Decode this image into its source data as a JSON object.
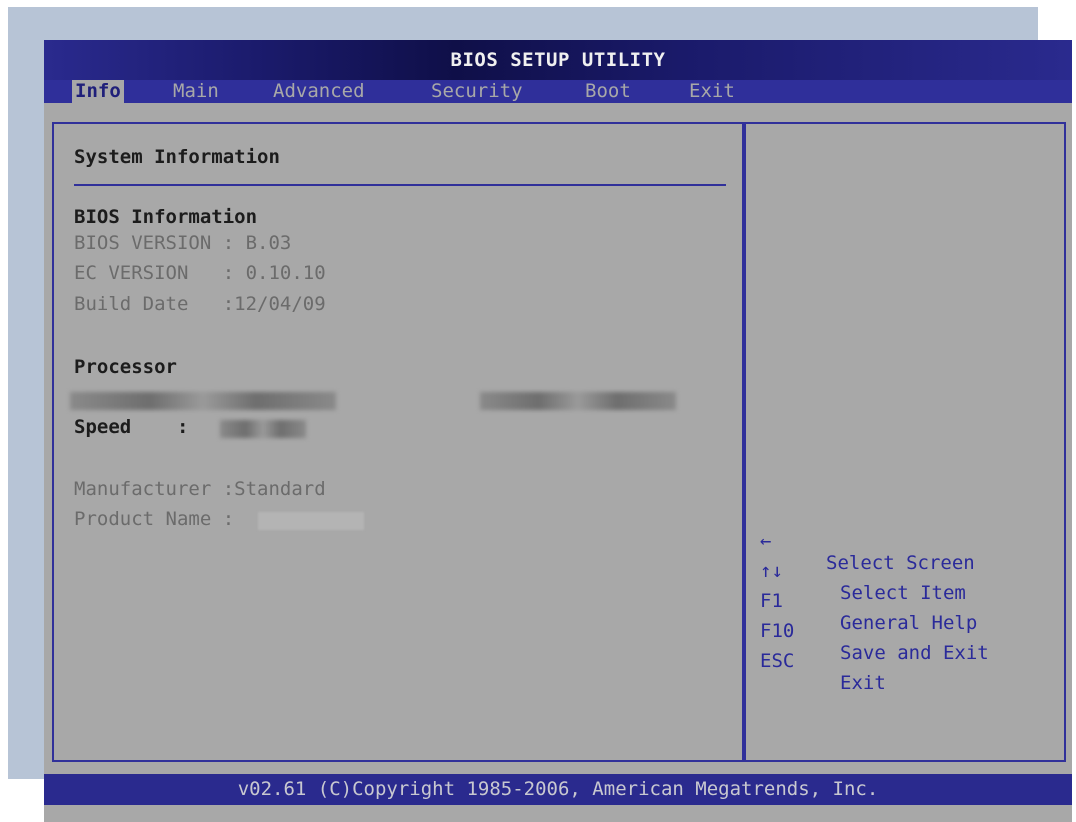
{
  "title": "BIOS SETUP UTILITY",
  "tabs": [
    {
      "label": "Info"
    },
    {
      "label": "Main"
    },
    {
      "label": "Advanced"
    },
    {
      "label": "Security"
    },
    {
      "label": "Boot"
    },
    {
      "label": "Exit"
    }
  ],
  "main": {
    "heading": "System Information",
    "bios_section": {
      "label": "BIOS Information",
      "rows": [
        "BIOS VERSION : B.03",
        "EC VERSION   : 0.10.10",
        "Build Date   :12/04/09"
      ]
    },
    "processor_section": {
      "label": "Processor",
      "speed_label": "Speed    :"
    },
    "system_rows": {
      "manufacturer": "Manufacturer :Standard",
      "product_name": "Product Name :"
    }
  },
  "help": [
    {
      "key": "←",
      "desc": "Select Screen"
    },
    {
      "key": "↑↓",
      "desc": "Select Item"
    },
    {
      "key": "F1",
      "desc": "General Help"
    },
    {
      "key": "F10",
      "desc": "Save and Exit"
    },
    {
      "key": "ESC",
      "desc": "Exit"
    }
  ],
  "footer": "v02.61 (C)Copyright 1985-2006, American Megatrends, Inc.",
  "colors": {
    "panel_bg": "#a8a8a8",
    "bar_blue": "#2a2a8e",
    "accent_text": "#2a2a9a"
  }
}
